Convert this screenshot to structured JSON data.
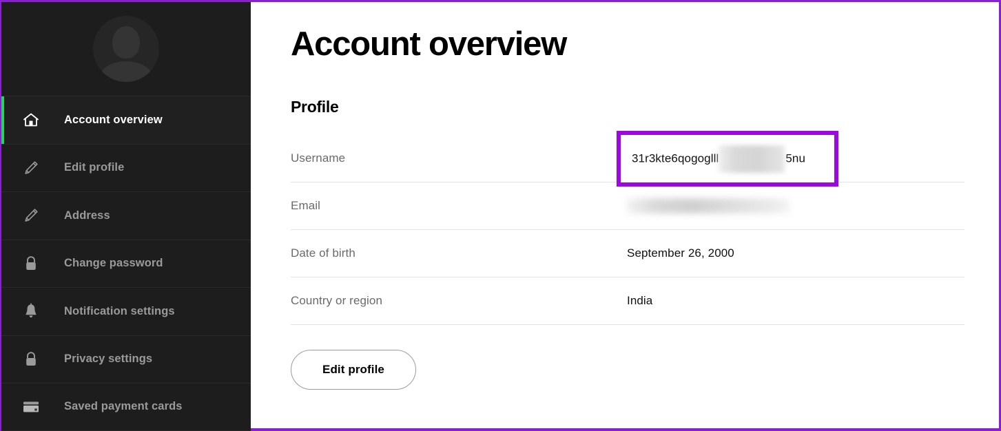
{
  "theme": {
    "sidebar_bg": "#1d1d1d",
    "accent_green": "#1ed760",
    "highlight_purple": "#9c09e0",
    "border_purple": "#8a1fd0",
    "label_gray": "#6a6a6a",
    "nav_label_gray": "#9a9a9a"
  },
  "sidebar": {
    "avatar_label": "profile-avatar",
    "items": [
      {
        "label": "Account overview",
        "icon": "home-icon",
        "active": true
      },
      {
        "label": "Edit profile",
        "icon": "pencil-icon",
        "active": false
      },
      {
        "label": "Address",
        "icon": "pencil-icon",
        "active": false
      },
      {
        "label": "Change password",
        "icon": "lock-icon",
        "active": false
      },
      {
        "label": "Notification settings",
        "icon": "bell-icon",
        "active": false
      },
      {
        "label": "Privacy settings",
        "icon": "lock-icon",
        "active": false
      },
      {
        "label": "Saved payment cards",
        "icon": "credit-card-icon",
        "active": false
      }
    ]
  },
  "main": {
    "page_title": "Account overview",
    "section_title": "Profile",
    "fields": [
      {
        "label": "Username",
        "value_prefix": "31r3kte6qogoglll",
        "value_suffix": "5nu",
        "redacted": true,
        "highlighted": true
      },
      {
        "label": "Email",
        "value_prefix": "",
        "value_suffix": "",
        "redacted": true,
        "highlighted": false
      },
      {
        "label": "Date of birth",
        "value": "September 26, 2000",
        "redacted": false,
        "highlighted": false
      },
      {
        "label": "Country or region",
        "value": "India",
        "redacted": false,
        "highlighted": false
      }
    ],
    "edit_profile_button": "Edit profile"
  }
}
